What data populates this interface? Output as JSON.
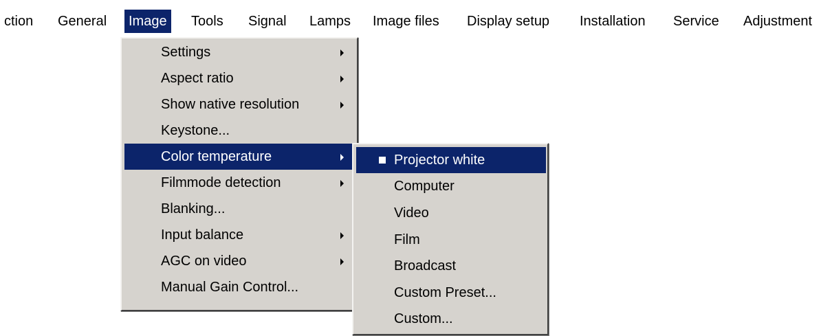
{
  "menubar": {
    "items": [
      {
        "label": "ction"
      },
      {
        "label": "General"
      },
      {
        "label": "Image"
      },
      {
        "label": "Tools"
      },
      {
        "label": "Signal"
      },
      {
        "label": "Lamps"
      },
      {
        "label": "Image files"
      },
      {
        "label": "Display setup"
      },
      {
        "label": "Installation"
      },
      {
        "label": "Service"
      },
      {
        "label": "Adjustment"
      }
    ],
    "active": "Image"
  },
  "image_menu": {
    "items": [
      {
        "label": "Settings",
        "submenu": true
      },
      {
        "label": "Aspect ratio",
        "submenu": true
      },
      {
        "label": "Show native resolution",
        "submenu": true
      },
      {
        "label": "Keystone...",
        "submenu": false
      },
      {
        "label": "Color temperature",
        "submenu": true,
        "highlighted": true
      },
      {
        "label": "Filmmode detection",
        "submenu": true
      },
      {
        "label": "Blanking...",
        "submenu": false
      },
      {
        "label": "Input balance",
        "submenu": true
      },
      {
        "label": "AGC on video",
        "submenu": true
      },
      {
        "label": "Manual Gain Control...",
        "submenu": false
      }
    ]
  },
  "color_temperature_menu": {
    "items": [
      {
        "label": "Projector white",
        "checked": true,
        "highlighted": true
      },
      {
        "label": "Computer"
      },
      {
        "label": "Video"
      },
      {
        "label": "Film"
      },
      {
        "label": "Broadcast"
      },
      {
        "label": "Custom Preset..."
      },
      {
        "label": "Custom..."
      }
    ]
  },
  "colors": {
    "menu_background": "#d6d3ce",
    "highlight": "#0c246a",
    "highlight_text": "#ffffff"
  }
}
